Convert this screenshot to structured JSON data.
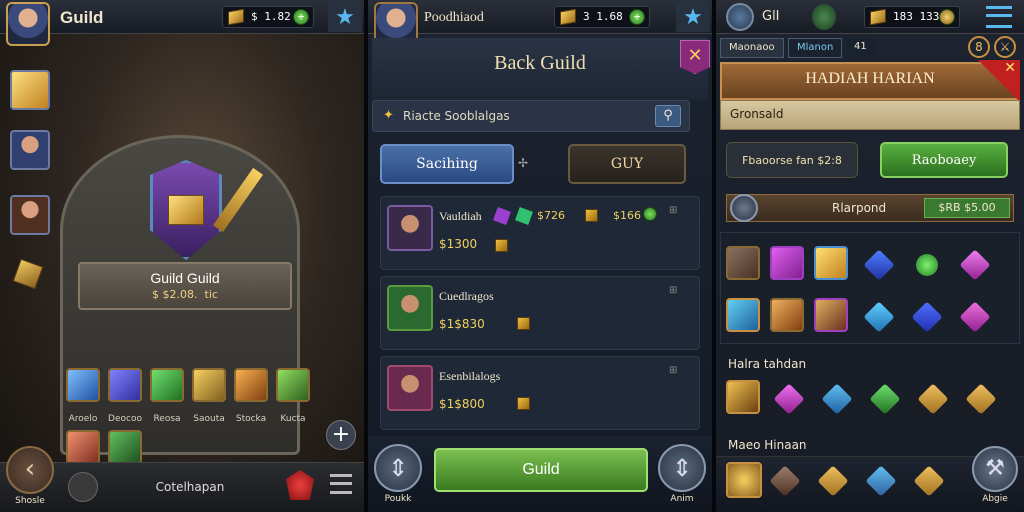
{
  "panel1": {
    "header_title": "Guild",
    "resource_value": "$ 1.82",
    "emblem_title": "Guild Guild",
    "emblem_subtitle": "$ $2.08.  tic",
    "item_labels": [
      "Aroelo",
      "Deocoo",
      "Reosa",
      "Saouta",
      "Stocka",
      "Kucta"
    ],
    "back_label": "Shosle",
    "bottom_text": "Cotelhapan",
    "plus": "+"
  },
  "panel2": {
    "header_title": "Poodhiaod",
    "resource_value": "3 1.68",
    "window_title": "Back Guild",
    "close": "✕",
    "search_text": "Riacte Sooblalgas",
    "filter_icon": "⚲",
    "tab_active": "Sacihing",
    "tab_other": "GUY",
    "members": [
      {
        "name": "Vauldiah",
        "price": "$1300",
        "stats": [
          "$726",
          "$166"
        ]
      },
      {
        "name": "Cuedlragos",
        "price": "$1$830"
      },
      {
        "name": "Esenbilalogs",
        "price": "$1$800"
      }
    ],
    "guild_button": "Guild",
    "left_label": "Poukk",
    "right_label": "Anim"
  },
  "panel3": {
    "header_title": "GlI",
    "resource_value": "183  133",
    "tab1": "Maonaoo",
    "tab2": "Mlanon",
    "tab3": "41",
    "banner_title": "HADIAH HARIAN",
    "sub_title": "Gronsald",
    "cost_label": "Fbaoorse fan  $2:8",
    "green_btn": "Raoboaey",
    "bar_label": "Rlarpond",
    "bar_value": "$RB $5.00",
    "section2": "Halra tahdan",
    "section3": "Maeo Hinaan",
    "corner_label": "Abgie"
  },
  "colors": {
    "accent": "#c8a050",
    "green": "#4a9a30",
    "blue": "#3a7ab8"
  }
}
